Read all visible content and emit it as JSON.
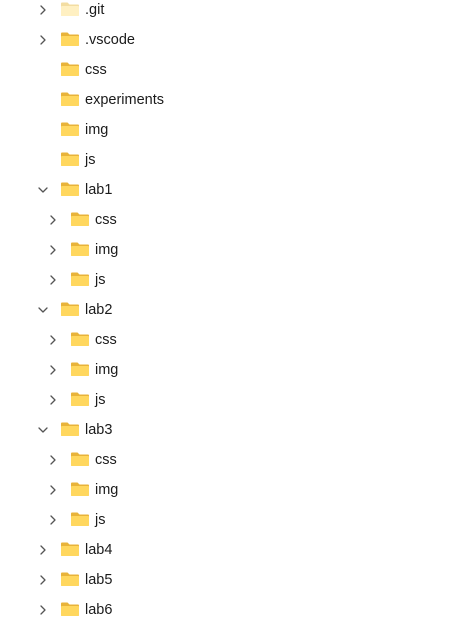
{
  "tree": {
    "items": [
      {
        "label": ".git",
        "level": 0,
        "expanded": false,
        "has_children": true,
        "partial": true
      },
      {
        "label": ".vscode",
        "level": 0,
        "expanded": false,
        "has_children": true
      },
      {
        "label": "css",
        "level": 0,
        "expanded": false,
        "has_children": false
      },
      {
        "label": "experiments",
        "level": 0,
        "expanded": false,
        "has_children": false
      },
      {
        "label": "img",
        "level": 0,
        "expanded": false,
        "has_children": false
      },
      {
        "label": "js",
        "level": 0,
        "expanded": false,
        "has_children": false
      },
      {
        "label": "lab1",
        "level": 0,
        "expanded": true,
        "has_children": true
      },
      {
        "label": "css",
        "level": 1,
        "expanded": false,
        "has_children": true
      },
      {
        "label": "img",
        "level": 1,
        "expanded": false,
        "has_children": true
      },
      {
        "label": "js",
        "level": 1,
        "expanded": false,
        "has_children": true
      },
      {
        "label": "lab2",
        "level": 0,
        "expanded": true,
        "has_children": true
      },
      {
        "label": "css",
        "level": 1,
        "expanded": false,
        "has_children": true
      },
      {
        "label": "img",
        "level": 1,
        "expanded": false,
        "has_children": true
      },
      {
        "label": "js",
        "level": 1,
        "expanded": false,
        "has_children": true
      },
      {
        "label": "lab3",
        "level": 0,
        "expanded": true,
        "has_children": true
      },
      {
        "label": "css",
        "level": 1,
        "expanded": false,
        "has_children": true
      },
      {
        "label": "img",
        "level": 1,
        "expanded": false,
        "has_children": true
      },
      {
        "label": "js",
        "level": 1,
        "expanded": false,
        "has_children": true
      },
      {
        "label": "lab4",
        "level": 0,
        "expanded": false,
        "has_children": true
      },
      {
        "label": "lab5",
        "level": 0,
        "expanded": false,
        "has_children": true
      },
      {
        "label": "lab6",
        "level": 0,
        "expanded": false,
        "has_children": true
      }
    ]
  },
  "colors": {
    "folder_back": "#e8b33a",
    "folder_front": "#ffd75e",
    "folder_front_faded": "#fff0c2",
    "folder_back_faded": "#f3dda2",
    "chevron": "#555555",
    "text": "#1b1b1b"
  },
  "icons": {
    "folder": "folder-icon",
    "collapsed": "chevron-right-icon",
    "expanded": "chevron-down-icon"
  }
}
